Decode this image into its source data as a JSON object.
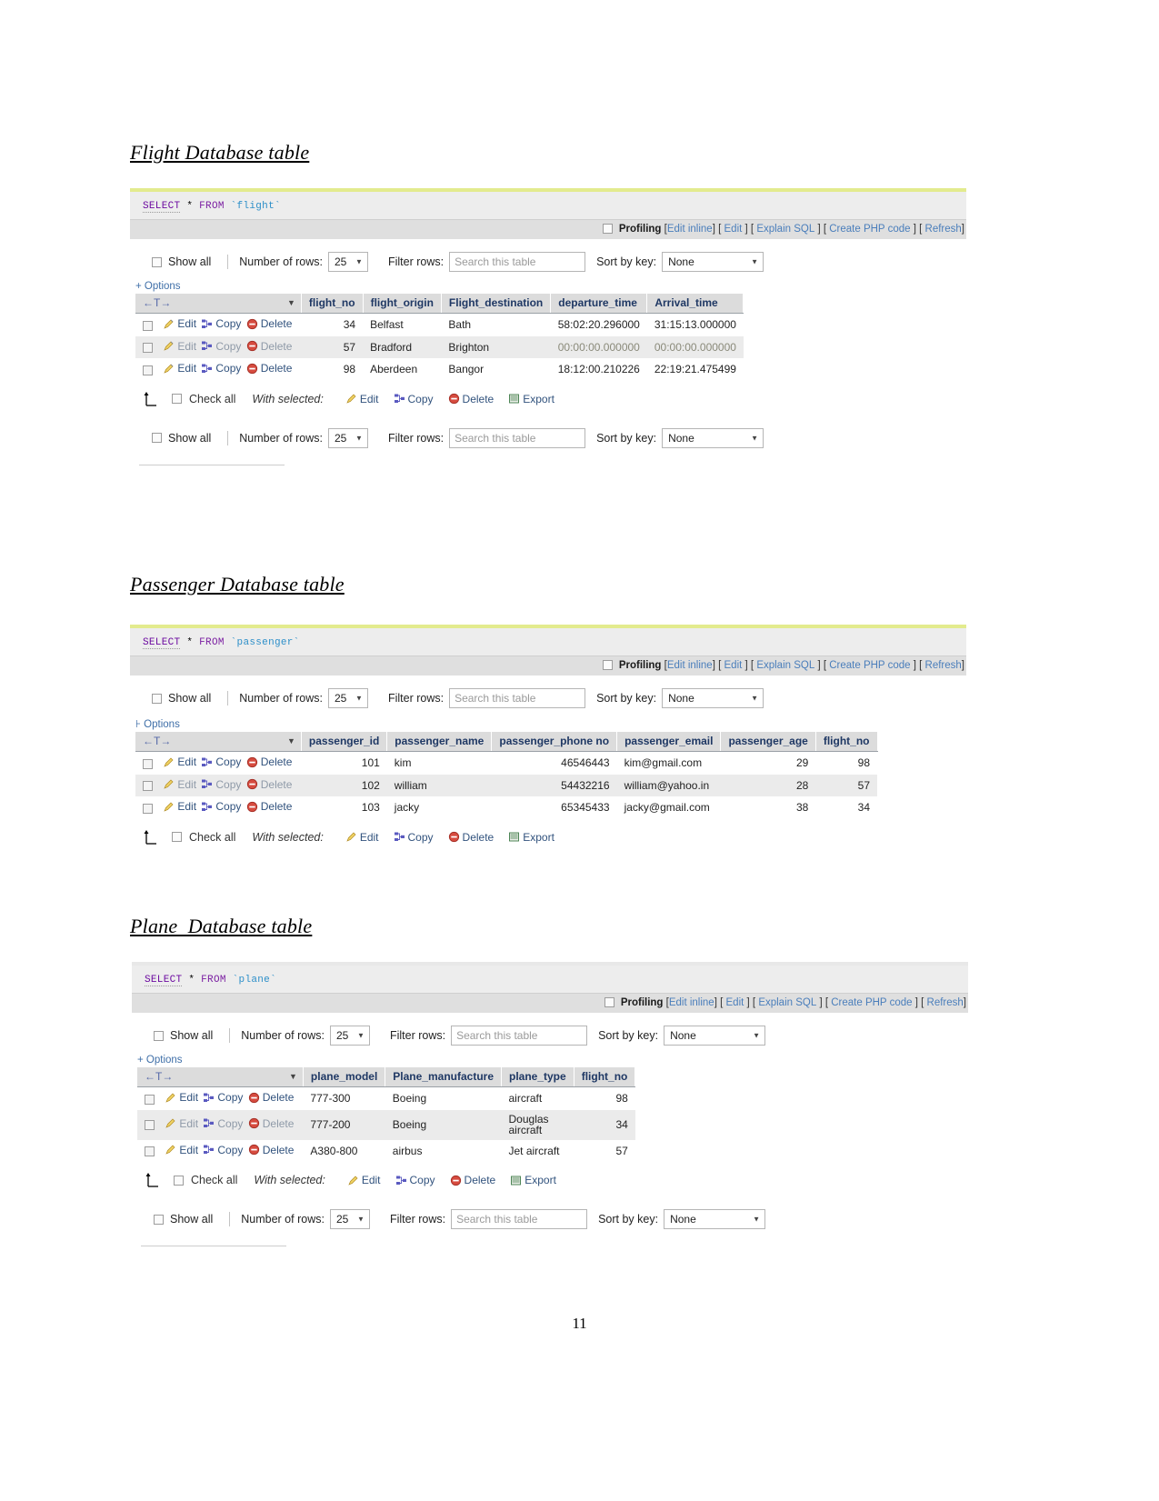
{
  "document": {
    "page_number": "11"
  },
  "sections": [
    {
      "id": "flight",
      "heading": "Flight Database table",
      "sql": {
        "keyword": "SELECT",
        "star": "*",
        "from": "FROM",
        "table": "`flight`"
      },
      "toolbar": {
        "profiling_label": "Profiling",
        "links": [
          "Edit inline",
          "Edit",
          "Explain SQL",
          "Create PHP code",
          "Refresh"
        ]
      },
      "controls": {
        "show_all": "Show all",
        "number_of_rows_label": "Number of rows:",
        "number_of_rows_value": "25",
        "filter_rows_label": "Filter rows:",
        "filter_rows_placeholder": "Search this table",
        "sort_by_key_label": "Sort by key:",
        "sort_by_key_value": "None"
      },
      "options_label": "+ Options",
      "nav_label": "←T→",
      "columns": [
        "flight_no",
        "flight_origin",
        "Flight_destination",
        "departure_time",
        "Arrival_time"
      ],
      "row_actions": [
        "Edit",
        "Copy",
        "Delete"
      ],
      "rows": [
        [
          "34",
          "Belfast",
          "Bath",
          "58:02:20.296000",
          "31:15:13.000000"
        ],
        [
          "57",
          "Bradford",
          "Brighton",
          "00:00:00.000000",
          "00:00:00.000000"
        ],
        [
          "98",
          "Aberdeen",
          "Bangor",
          "18:12:00.210226",
          "22:19:21.475499"
        ]
      ],
      "footer": {
        "check_all": "Check all",
        "with_selected": "With selected:",
        "actions": [
          "Edit",
          "Copy",
          "Delete",
          "Export"
        ]
      },
      "has_bottom_controls": true
    },
    {
      "id": "passenger",
      "heading": "Passenger Database table",
      "sql": {
        "keyword": "SELECT",
        "star": "*",
        "from": "FROM",
        "table": "`passenger`"
      },
      "toolbar": {
        "profiling_label": "Profiling",
        "links": [
          "Edit inline",
          "Edit",
          "Explain SQL",
          "Create PHP code",
          "Refresh"
        ]
      },
      "controls": {
        "show_all": "Show all",
        "number_of_rows_label": "Number of rows:",
        "number_of_rows_value": "25",
        "filter_rows_label": "Filter rows:",
        "filter_rows_placeholder": "Search this table",
        "sort_by_key_label": "Sort by key:",
        "sort_by_key_value": "None"
      },
      "options_label": "⊦ Options",
      "nav_label": "←T→",
      "columns": [
        "passenger_id",
        "passenger_name",
        "passenger_phone no",
        "passenger_email",
        "passenger_age",
        "flight_no"
      ],
      "row_actions": [
        "Edit",
        "Copy",
        "Delete"
      ],
      "rows": [
        [
          "101",
          "kim",
          "46546443",
          "kim@gmail.com",
          "29",
          "98"
        ],
        [
          "102",
          "william",
          "54432216",
          "william@yahoo.in",
          "28",
          "57"
        ],
        [
          "103",
          "jacky",
          "65345433",
          "jacky@gmail.com",
          "38",
          "34"
        ]
      ],
      "footer": {
        "check_all": "Check all",
        "with_selected": "With selected:",
        "actions": [
          "Edit",
          "Copy",
          "Delete",
          "Export"
        ]
      },
      "has_bottom_controls": false
    },
    {
      "id": "plane",
      "heading": "Plane  Database table",
      "sql": {
        "keyword": "SELECT",
        "star": "*",
        "from": "FROM",
        "table": "`plane`"
      },
      "toolbar": {
        "profiling_label": "Profiling",
        "links": [
          "Edit inline",
          "Edit",
          "Explain SQL",
          "Create PHP code",
          "Refresh"
        ]
      },
      "controls": {
        "show_all": "Show all",
        "number_of_rows_label": "Number of rows:",
        "number_of_rows_value": "25",
        "filter_rows_label": "Filter rows:",
        "filter_rows_placeholder": "Search this table",
        "sort_by_key_label": "Sort by key:",
        "sort_by_key_value": "None"
      },
      "options_label": "+ Options",
      "nav_label": "←T→",
      "columns": [
        "plane_model",
        "Plane_manufacture",
        "plane_type",
        "flight_no"
      ],
      "row_actions": [
        "Edit",
        "Copy",
        "Delete"
      ],
      "rows": [
        [
          "777-300",
          "Boeing",
          "aircraft",
          "98"
        ],
        [
          "777-200",
          "Boeing",
          "Douglas aircraft",
          "34"
        ],
        [
          "A380-800",
          "airbus",
          "Jet aircraft",
          "57"
        ]
      ],
      "footer": {
        "check_all": "Check all",
        "with_selected": "With selected:",
        "actions": [
          "Edit",
          "Copy",
          "Delete",
          "Export"
        ]
      },
      "has_bottom_controls": true
    }
  ]
}
